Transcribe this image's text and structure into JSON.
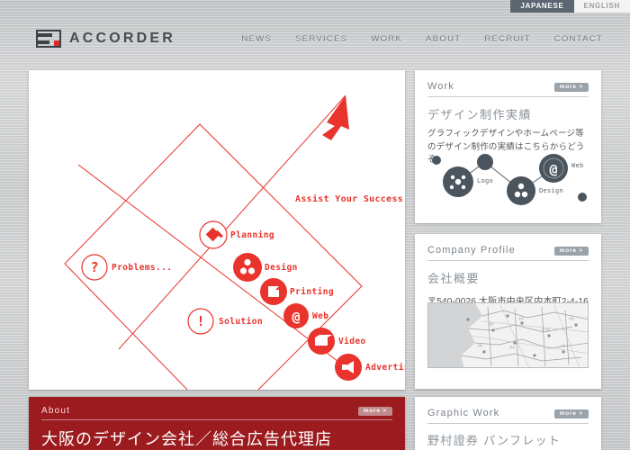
{
  "lang": {
    "japanese": "JAPANESE",
    "english": "ENGLISH"
  },
  "brand": {
    "name": "ACCORDER"
  },
  "nav": {
    "items": [
      {
        "label": "NEWS"
      },
      {
        "label": "SERVICES"
      },
      {
        "label": "WORK"
      },
      {
        "label": "ABOUT"
      },
      {
        "label": "RECRUIT"
      },
      {
        "label": "CONTACT"
      }
    ]
  },
  "hero": {
    "tagline": "Assist Your Success!",
    "problems_label": "Problems...",
    "solution_label": "Solution",
    "nodes": [
      {
        "label": "Planning",
        "icon": "gavel-icon",
        "filled": false
      },
      {
        "label": "Design",
        "icon": "palette-icon",
        "filled": true
      },
      {
        "label": "Printing",
        "icon": "printer-icon",
        "filled": true
      },
      {
        "label": "Web",
        "icon": "at-icon",
        "filled": true
      },
      {
        "label": "Video",
        "icon": "film-icon",
        "filled": true
      },
      {
        "label": "Advertising",
        "icon": "megaphone-icon",
        "filled": true
      }
    ],
    "accent_color": "#e8342c"
  },
  "work": {
    "title": "Work",
    "more": "more >",
    "jp_subtitle": "デザイン制作実績",
    "jp_body": "グラフィックデザインやホームページ等のデザイン制作の実績はこちらからどうぞ。",
    "diagram_labels": [
      {
        "label": "Logo"
      },
      {
        "label": "Design"
      },
      {
        "label": "Web"
      }
    ],
    "node_color": "#4b555e"
  },
  "profile": {
    "title": "Company Profile",
    "more": "more >",
    "jp_subtitle": "会社概要",
    "address": "〒540-0026 大阪市中央区内本町2-4-16"
  },
  "graphic": {
    "title": "Graphic Work",
    "more": "more >",
    "jp_subtitle": "野村證券 パンフレット"
  },
  "about": {
    "title": "About",
    "more": "more >",
    "jp_heading": "大阪のデザイン会社／総合広告代理店",
    "bg_color": "#9c1b1f"
  }
}
